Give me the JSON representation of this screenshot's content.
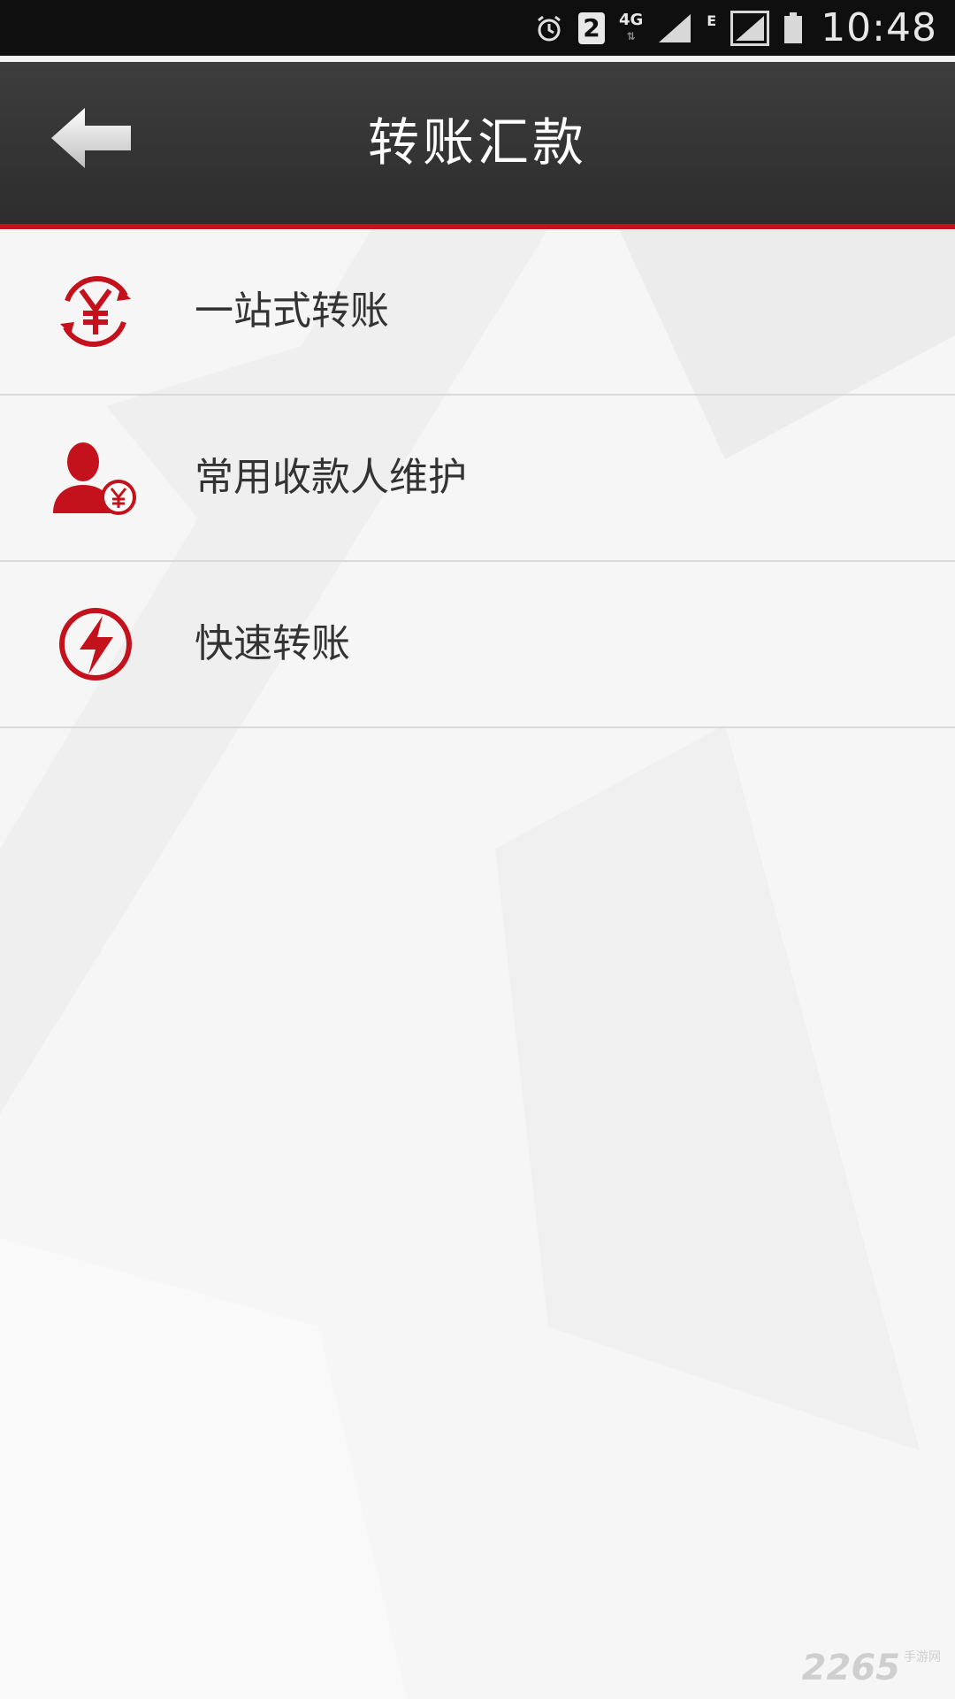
{
  "status_bar": {
    "sim_slot": "2",
    "network_type": "4G",
    "secondary_network": "E",
    "time": "10:48",
    "icons": [
      "alarm-icon",
      "sim-2-icon",
      "signal-icon",
      "battery-icon"
    ]
  },
  "header": {
    "title": "转账汇款",
    "back_icon": "back-arrow-icon"
  },
  "menu": {
    "items": [
      {
        "label": "一站式转账",
        "icon": "yuan-cycle-icon"
      },
      {
        "label": "常用收款人维护",
        "icon": "payee-icon"
      },
      {
        "label": "快速转账",
        "icon": "lightning-icon"
      }
    ]
  },
  "watermark": {
    "brand": "2265",
    "sub": "手游网"
  },
  "colors": {
    "accent": "#c4121d",
    "header_bg": "#333333",
    "text": "#333333"
  }
}
